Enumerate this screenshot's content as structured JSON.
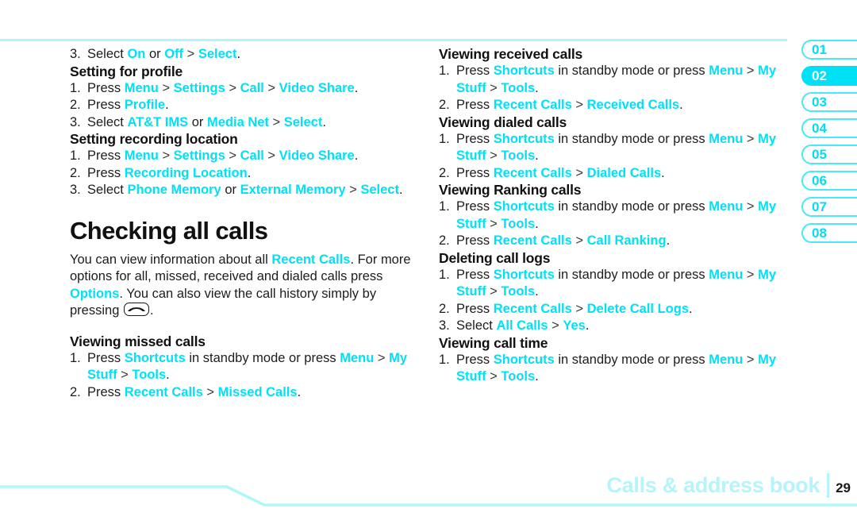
{
  "document": {
    "footer_title": "Calls & address book",
    "page_number": "29"
  },
  "tabs": [
    {
      "label": "01",
      "active": false
    },
    {
      "label": "02",
      "active": true
    },
    {
      "label": "03",
      "active": false
    },
    {
      "label": "04",
      "active": false
    },
    {
      "label": "05",
      "active": false
    },
    {
      "label": "06",
      "active": false
    },
    {
      "label": "07",
      "active": false
    },
    {
      "label": "08",
      "active": false
    }
  ],
  "left_column": {
    "orphan_step": {
      "num": "3.",
      "lead": "Select ",
      "k1": "On",
      "mid": " or ",
      "k2": "Off",
      "gt": " > ",
      "k3": "Select",
      "end": "."
    },
    "setting_for_profile": {
      "title": "Setting for profile",
      "step1": {
        "num": "1.",
        "lead": "Press ",
        "k1": "Menu",
        "g1": " > ",
        "k2": "Settings",
        "g2": " > ",
        "k3": "Call",
        "g3": " > ",
        "k4": "Video Share",
        "end": "."
      },
      "step2": {
        "num": "2.",
        "lead": "Press ",
        "k1": "Profile",
        "end": "."
      },
      "step3": {
        "num": "3.",
        "lead": "Select ",
        "k1": "AT&T IMS",
        "mid": " or ",
        "k2": "Media Net",
        "gt": " > ",
        "k3": "Select",
        "end": "."
      }
    },
    "setting_recording_location": {
      "title": "Setting recording location",
      "step1": {
        "num": "1.",
        "lead": "Press ",
        "k1": "Menu",
        "g1": " > ",
        "k2": "Settings",
        "g2": " > ",
        "k3": "Call",
        "g3": " > ",
        "k4": "Video Share",
        "end": "."
      },
      "step2": {
        "num": "2.",
        "lead": "Press ",
        "k1": "Recording Location",
        "end": "."
      },
      "step3": {
        "num": "3.",
        "lead": "Select ",
        "k1": "Phone Memory",
        "mid": " or ",
        "k2": "External Memory",
        "gt": " > ",
        "k3": "Select",
        "end": "."
      }
    },
    "checking_all_calls": {
      "title": "Checking all calls",
      "body_a": "You can view information about all ",
      "body_k1": "Recent Calls",
      "body_b": ". For more options for all, missed, received and dialed calls press ",
      "body_k2": "Options",
      "body_c": ". You can also view the call history simply by pressing ",
      "body_d": "."
    },
    "viewing_missed_calls": {
      "title": "Viewing missed calls",
      "step1": {
        "num": "1.",
        "lead": "Press ",
        "k1": "Shortcuts",
        "mid": " in standby mode or press ",
        "k2": "Menu",
        "g1": " > ",
        "k3": "My Stuff",
        "g2": " > ",
        "k4": "Tools",
        "end": "."
      },
      "step2": {
        "num": "2.",
        "lead": "Press ",
        "k1": "Recent Calls",
        "g1": " > ",
        "k2": "Missed Calls",
        "end": "."
      }
    }
  },
  "right_column": {
    "viewing_received_calls": {
      "title": "Viewing received calls",
      "step1": {
        "num": "1.",
        "lead": "Press ",
        "k1": "Shortcuts",
        "mid": " in standby mode or press ",
        "k2": "Menu",
        "g1": " > ",
        "k3": "My Stuff",
        "g2": " > ",
        "k4": "Tools",
        "end": "."
      },
      "step2": {
        "num": "2.",
        "lead": "Press ",
        "k1": "Recent Calls",
        "g1": " > ",
        "k2": "Received Calls",
        "end": "."
      }
    },
    "viewing_dialed_calls": {
      "title": "Viewing dialed calls",
      "step1": {
        "num": "1.",
        "lead": "Press ",
        "k1": "Shortcuts",
        "mid": " in standby mode or press ",
        "k2": "Menu",
        "g1": " > ",
        "k3": "My Stuff",
        "g2": " > ",
        "k4": "Tools",
        "end": "."
      },
      "step2": {
        "num": "2.",
        "lead": "Press ",
        "k1": "Recent Calls",
        "g1": " > ",
        "k2": "Dialed Calls",
        "end": "."
      }
    },
    "viewing_ranking_calls": {
      "title": "Viewing Ranking calls",
      "step1": {
        "num": "1.",
        "lead": "Press ",
        "k1": "Shortcuts",
        "mid": " in standby mode or press ",
        "k2": "Menu",
        "g1": " > ",
        "k3": "My Stuff",
        "g2": " > ",
        "k4": "Tools",
        "end": "."
      },
      "step2": {
        "num": "2.",
        "lead": "Press ",
        "k1": "Recent Calls",
        "g1": " > ",
        "k2": "Call Ranking",
        "end": "."
      }
    },
    "deleting_call_logs": {
      "title": "Deleting call logs",
      "step1": {
        "num": "1.",
        "lead": "Press ",
        "k1": "Shortcuts",
        "mid": " in standby mode or press ",
        "k2": "Menu",
        "g1": " > ",
        "k3": "My Stuff",
        "g2": " > ",
        "k4": "Tools",
        "end": "."
      },
      "step2": {
        "num": "2.",
        "lead": "Press ",
        "k1": "Recent Calls",
        "g1": " > ",
        "k2": "Delete Call Logs",
        "end": "."
      },
      "step3": {
        "num": "3.",
        "lead": "Select ",
        "k1": "All Calls",
        "g1": " > ",
        "k2": "Yes",
        "end": "."
      }
    },
    "viewing_call_time": {
      "title": "Viewing call time",
      "step1": {
        "num": "1.",
        "lead": "Press ",
        "k1": "Shortcuts",
        "mid": " in standby mode or press ",
        "k2": "Menu",
        "g1": " > ",
        "k3": "My Stuff",
        "g2": " > ",
        "k4": "Tools",
        "end": "."
      }
    }
  },
  "colors": {
    "accent_cyan": "#00e1f5",
    "frame_cyan": "#aff7fb",
    "footer_cyan": "#b4f4fb"
  }
}
